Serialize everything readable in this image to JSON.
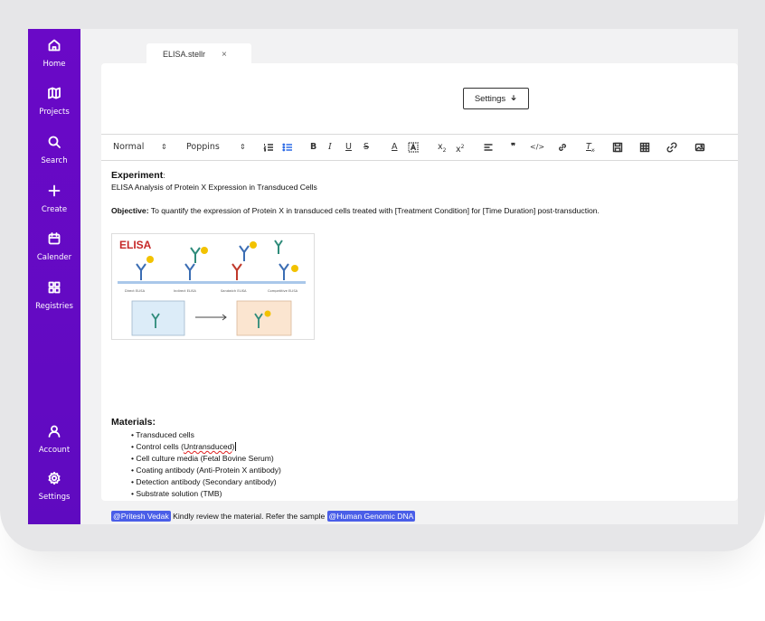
{
  "sidebar": {
    "items": [
      {
        "label": "Home",
        "icon": "home-icon"
      },
      {
        "label": "Projects",
        "icon": "map-icon"
      },
      {
        "label": "Search",
        "icon": "search-icon"
      },
      {
        "label": "Create",
        "icon": "plus-icon"
      },
      {
        "label": "Calender",
        "icon": "calendar-icon"
      },
      {
        "label": "Registries",
        "icon": "grid-icon"
      },
      {
        "label": "Account",
        "icon": "user-icon"
      },
      {
        "label": "Settings",
        "icon": "gear-icon"
      }
    ],
    "color": "#6a09c7"
  },
  "tab": {
    "label": "ELISA.stellr",
    "close": "×"
  },
  "settings_button": {
    "label": "Settings",
    "icon": "arrow-down-icon"
  },
  "toolbar": {
    "paragraph_style": "Normal",
    "font": "Poppins",
    "arrows": "⇕"
  },
  "document": {
    "experiment_heading": "Experiment",
    "experiment_colon": ":",
    "experiment_title": "ELISA Analysis of Protein X Expression in Transduced Cells",
    "objective_label": "Objective:",
    "objective_text": " To quantify the expression of Protein X in transduced cells treated with [Treatment Condition] for [Time Duration] post-transduction.",
    "figure": {
      "title": "ELISA",
      "captions": [
        "Direct ELISA",
        "Indirect ELISA",
        "Sandwich ELISA",
        "Competitive ELISA"
      ]
    },
    "materials_heading": "Materials:",
    "materials": [
      "Transduced cells",
      "Control cells (Untransduced)",
      "Cell culture media (Fetal Bovine Serum)",
      "Coating antibody (Anti-Protein X antibody)",
      "Detection antibody (Secondary antibody)",
      "Substrate solution (TMB)"
    ],
    "control_prefix": "Control cells (",
    "control_squiggle": "Untransduced",
    "control_suffix": ")",
    "bullet_char": "•",
    "mention_user": "@Pritesh Vedak",
    "comment_text": " Kindly review the material. Refer the sample ",
    "mention_sample": "@Human Genomic DNA"
  },
  "colors": {
    "accent": "#4a5ee8",
    "sidebar": "#6a09c7"
  }
}
